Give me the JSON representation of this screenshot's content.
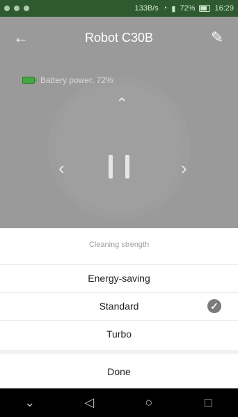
{
  "status_bar": {
    "left_text": "",
    "network": "133B/s",
    "battery_percent": "72%",
    "time": "16:29"
  },
  "appbar": {
    "title": "Robot C30B",
    "back_icon": "arrow-left-icon",
    "edit_icon": "pencil-icon"
  },
  "battery": {
    "label": "Battery power: 72%",
    "color": "#44a844"
  },
  "dial": {
    "up_icon": "chevron-up-icon",
    "left_icon": "chevron-left-icon",
    "right_icon": "chevron-right-icon",
    "center_icon": "pause-icon"
  },
  "sheet": {
    "title": "Cleaning strength",
    "options": [
      {
        "label": "Energy-saving",
        "selected": false
      },
      {
        "label": "Standard",
        "selected": true
      },
      {
        "label": "Turbo",
        "selected": false
      }
    ],
    "done_label": "Done"
  },
  "nav": {
    "back_icon": "triangle-back-icon",
    "home_icon": "circle-home-icon",
    "recents_icon": "square-recents-icon",
    "down_icon": "chevron-down-icon"
  }
}
